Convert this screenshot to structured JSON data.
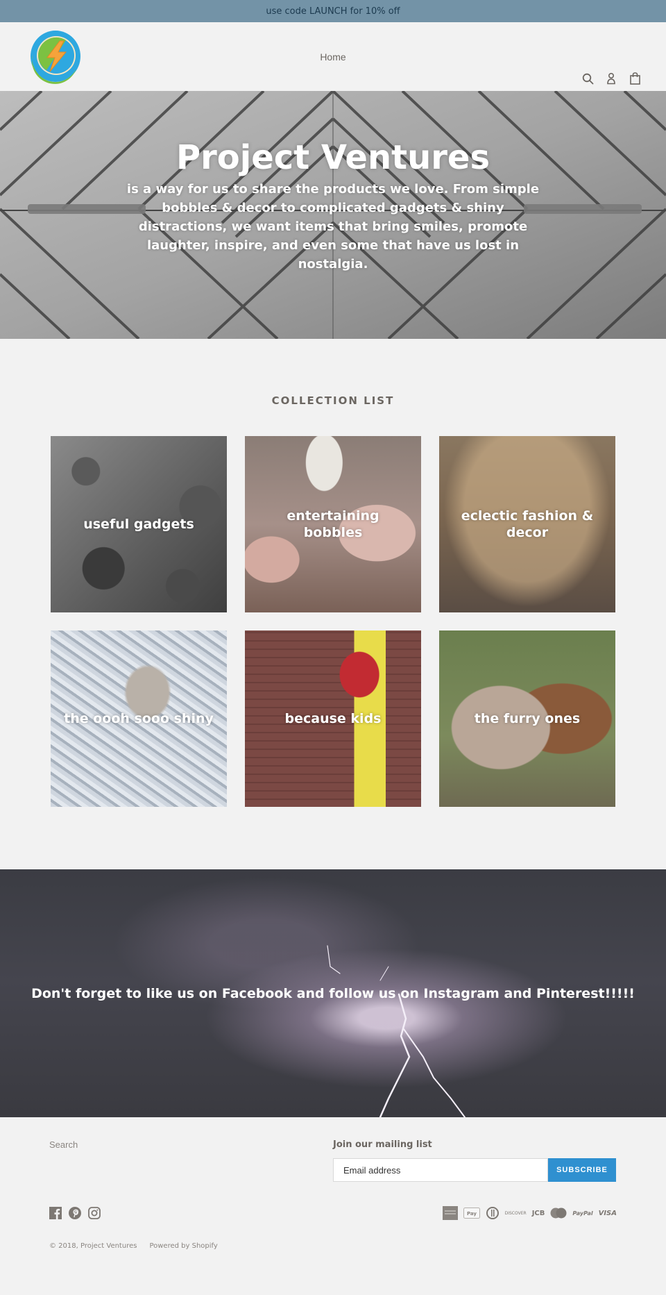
{
  "announcement": {
    "text": "use code LAUNCH for 10% off"
  },
  "header": {
    "logo_alt": "Project Ventures",
    "nav": [
      {
        "label": "Home"
      }
    ],
    "icons": [
      "search-icon",
      "account-icon",
      "cart-icon"
    ]
  },
  "hero": {
    "title": "Project Ventures",
    "text": "is a way for us to share the products we love. From simple bobbles & decor to complicated gadgets & shiny distractions, we want items that bring smiles, promote laughter, inspire, and even some that have us lost in nostalgia."
  },
  "collections": {
    "title": "COLLECTION LIST",
    "items": [
      {
        "label": "useful gadgets"
      },
      {
        "label": "entertaining bobbles"
      },
      {
        "label": "eclectic fashion & decor"
      },
      {
        "label": "the oooh sooo shiny"
      },
      {
        "label": "because kids"
      },
      {
        "label": "the furry ones"
      }
    ]
  },
  "banner": {
    "text": "Don't forget to like us on Facebook and follow us on Instagram and Pinterest!!!!!"
  },
  "footer": {
    "links": [
      {
        "label": "Search"
      }
    ],
    "mailing": {
      "title": "Join our mailing list",
      "placeholder": "Email address",
      "button": "SUBSCRIBE"
    },
    "social": [
      "facebook-icon",
      "pinterest-icon",
      "instagram-icon"
    ],
    "payments": [
      "American Express",
      "Apple Pay",
      "Diners Club",
      "Discover",
      "JCB",
      "Master",
      "PayPal",
      "Visa"
    ],
    "payment_labels": {
      "discover": "DISCOVER",
      "jcb": "JCB",
      "paypal": "PayPal",
      "visa": "VISA"
    },
    "copyright": "© 2018, Project Ventures",
    "powered": "Powered by Shopify"
  },
  "colors": {
    "announcement_bg": "#7393a7",
    "page_bg": "#f2f2f2",
    "accent": "#2f90d0",
    "text": "#6b6661"
  }
}
